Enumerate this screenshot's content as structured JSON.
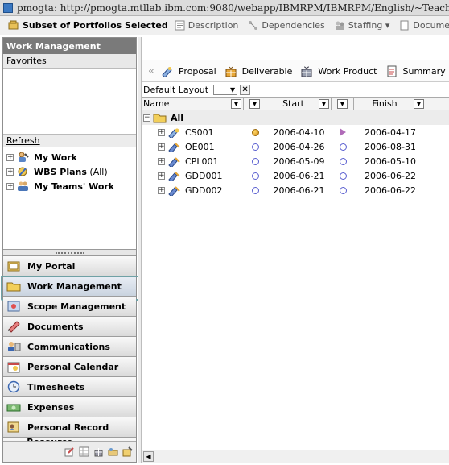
{
  "window": {
    "title": "pmogta: http://pmogta.mtllab.ibm.com:9080/webapp/IBMRPM/IBMRPM/English/~Teacher"
  },
  "toolbar": {
    "subset_label": "Subset of Portfolios Selected",
    "items": [
      "Description",
      "Dependencies",
      "Staffing ▾",
      "Documen"
    ]
  },
  "leftpanel": {
    "header": "Work Management",
    "favorites_label": "Favorites",
    "refresh_label": "Refresh",
    "tree": [
      {
        "label": "My Work",
        "suffix": ""
      },
      {
        "label": "WBS Plans",
        "suffix": " (All)"
      },
      {
        "label": "My Teams' Work",
        "suffix": ""
      }
    ],
    "nav": [
      {
        "label": "My Portal"
      },
      {
        "label": "Work Management"
      },
      {
        "label": "Scope Management"
      },
      {
        "label": "Documents"
      },
      {
        "label": "Communications"
      },
      {
        "label": "Personal Calendar"
      },
      {
        "label": "Timesheets"
      },
      {
        "label": "Expenses"
      },
      {
        "label": "Personal Record"
      },
      {
        "label": "Resource Management"
      }
    ]
  },
  "rightpanel": {
    "toolbar": {
      "chevron": "«",
      "items": [
        "Proposal",
        "Deliverable",
        "Work Product",
        "Summary"
      ]
    },
    "layout_label": "Default Layout",
    "columns": {
      "name": "Name",
      "start": "Start",
      "finish": "Finish"
    },
    "root_label": "All",
    "rows": [
      {
        "name": "CS001",
        "start": "2006-04-10",
        "finish": "2006-04-17",
        "start_ind": "filled",
        "finish_ind": "diamond"
      },
      {
        "name": "OE001",
        "start": "2006-04-26",
        "finish": "2006-08-31",
        "start_ind": "open",
        "finish_ind": "open"
      },
      {
        "name": "CPL001",
        "start": "2006-05-09",
        "finish": "2006-05-10",
        "start_ind": "open",
        "finish_ind": "open"
      },
      {
        "name": "GDD001",
        "start": "2006-06-21",
        "finish": "2006-06-22",
        "start_ind": "open",
        "finish_ind": "open"
      },
      {
        "name": "GDD002",
        "start": "2006-06-21",
        "finish": "2006-06-22",
        "start_ind": "open",
        "finish_ind": "open"
      }
    ]
  },
  "colors": {
    "panel_header": "#7a7a7a",
    "active_outline": "#6fa1a5",
    "open_indicator": "#5a5fd0",
    "filled_indicator": "#d28a10",
    "diamond_indicator": "#b06bb8"
  }
}
